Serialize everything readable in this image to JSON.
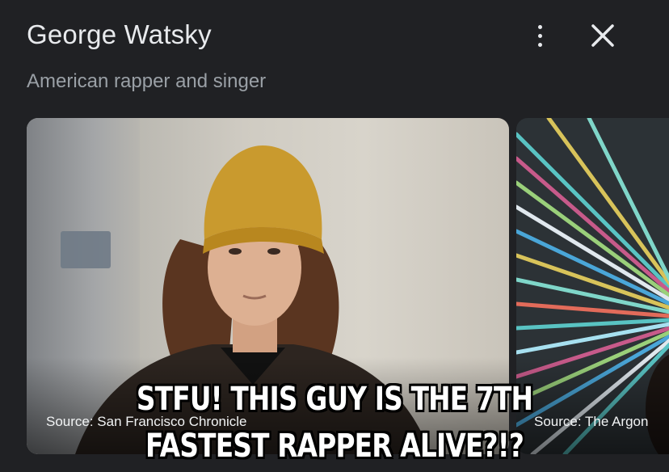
{
  "panel": {
    "title": "George Watsky",
    "subtitle": "American rapper and singer"
  },
  "images": [
    {
      "source": "Source: San Francisco Chronicle"
    },
    {
      "source": "Source: The Argon"
    }
  ],
  "meme": {
    "line1": "STFU! THIS GUY IS THE 7TH",
    "line2": "FASTEST RAPPER ALIVE?!?"
  },
  "icons": {
    "more": "more-vert-icon",
    "close": "close-icon"
  }
}
